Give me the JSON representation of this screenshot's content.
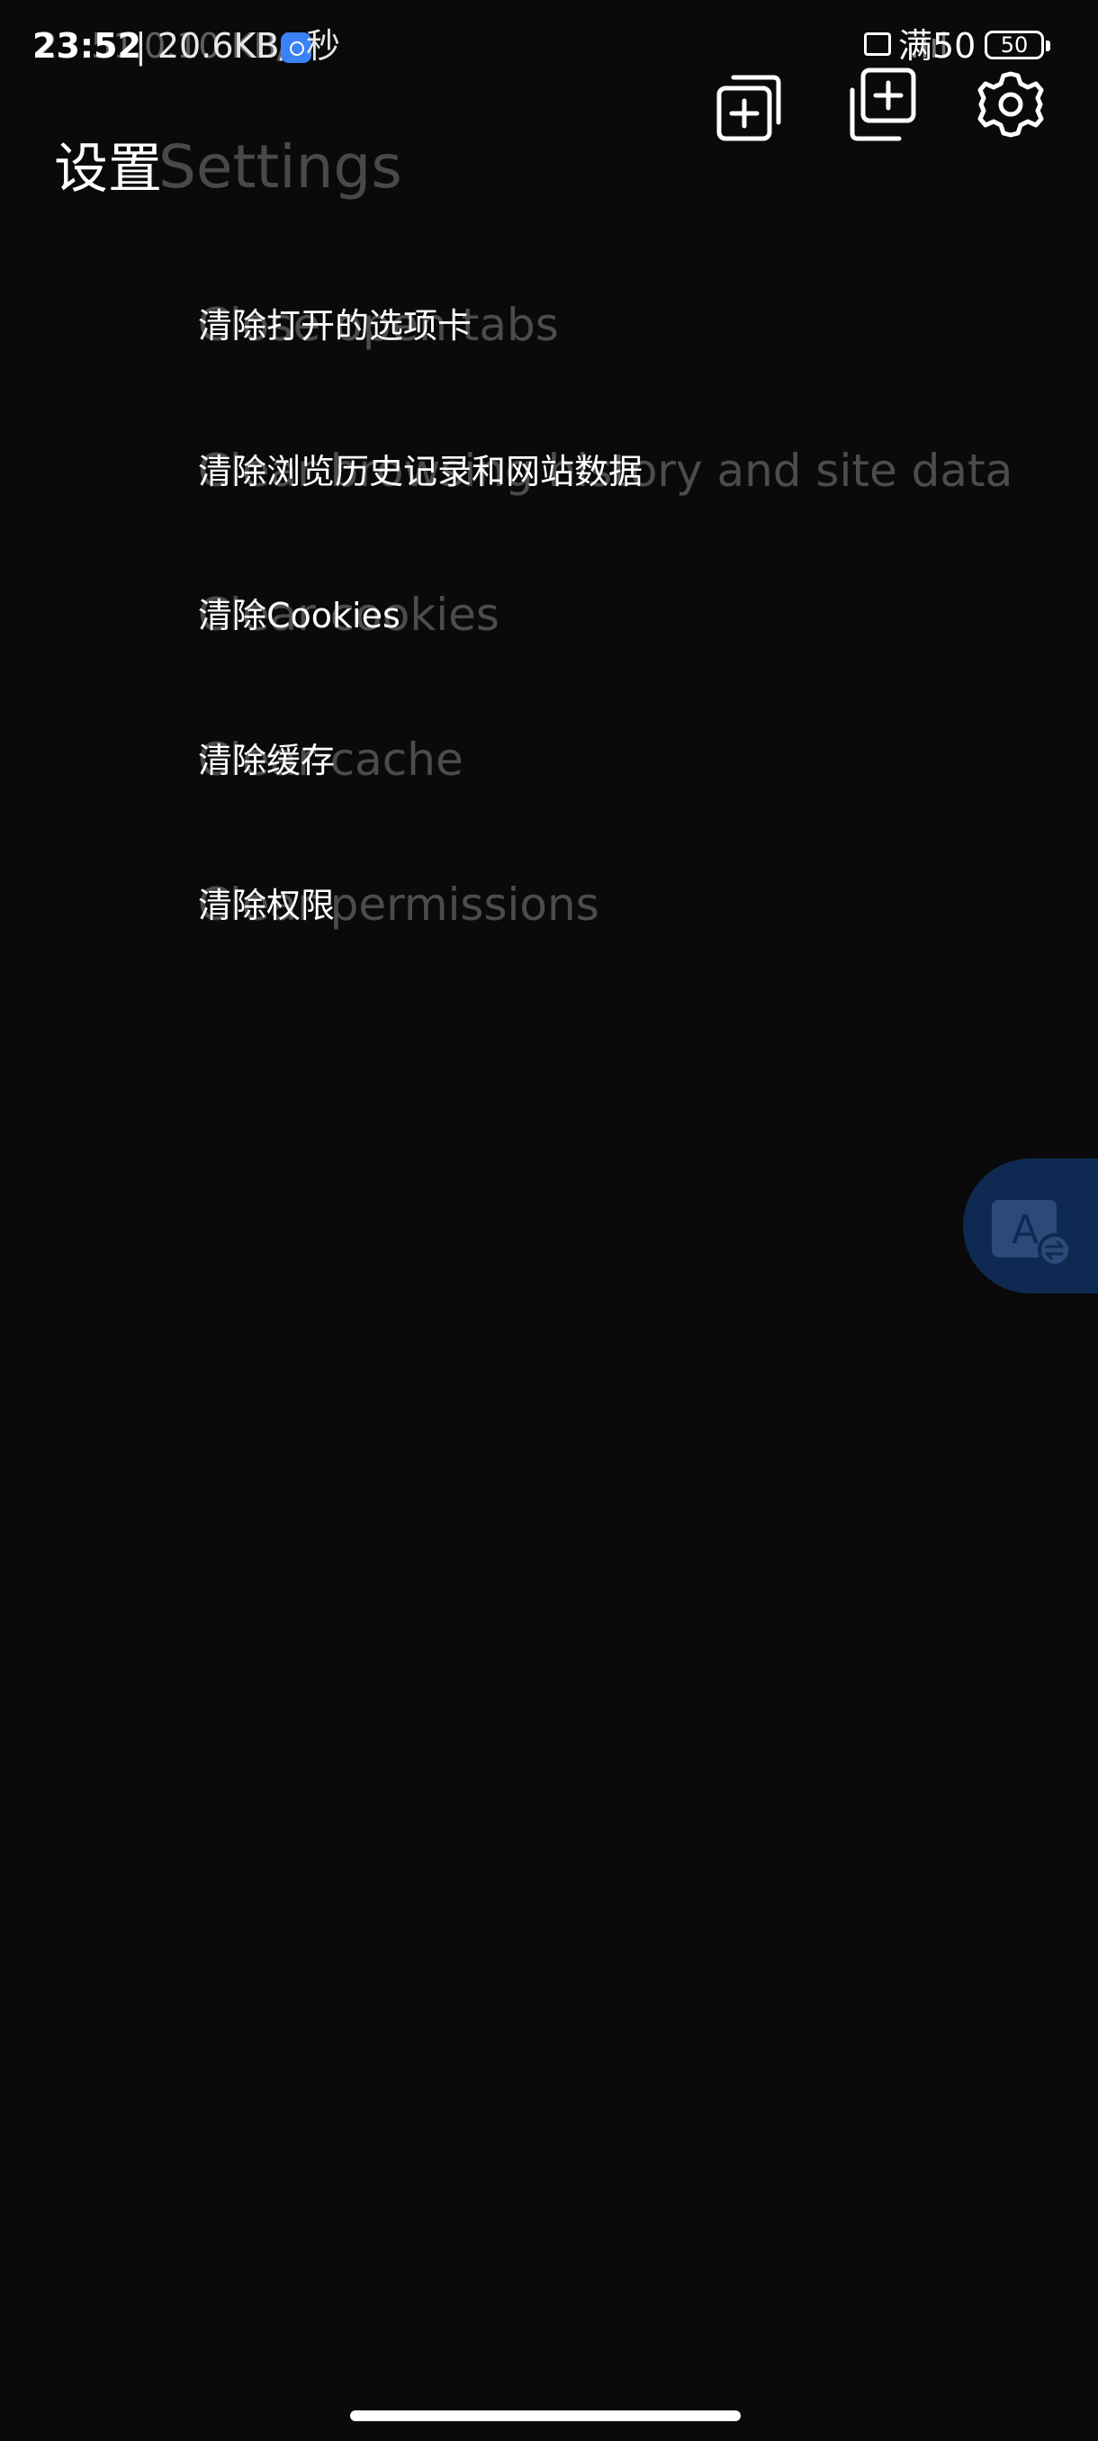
{
  "status_bar": {
    "time": "23:52",
    "time_ghost": "23:51",
    "net_speed": "| 20.6KB/s",
    "net_speed_ghost": "0.10 KB/s",
    "speed_suffix": "秒",
    "carrier": "满50",
    "carrier_ghost": ".ııl",
    "battery": "50",
    "app_icon": "message-app-icon",
    "sim_icon": "sim-card-icon"
  },
  "toolbar": {
    "duplicate_tab_icon": "duplicate-tab-icon",
    "new_tab_icon": "new-tab-icon",
    "settings_icon": "gear-icon"
  },
  "header": {
    "title_cn": "设置",
    "title_en": "Settings"
  },
  "menu": {
    "items": [
      {
        "cn": "清除打开的选项卡",
        "en": "Close open tabs"
      },
      {
        "cn": "清除浏览历史记录和网站数据",
        "en": "Clear browsing history and site data"
      },
      {
        "cn": "清除Cookies",
        "en": "Clear cookies"
      },
      {
        "cn": "清除缓存",
        "en": "Clear cache"
      },
      {
        "cn": "清除权限",
        "en": "Clear permissions"
      }
    ]
  },
  "floating": {
    "translate_icon": "translate-icon",
    "accent_color": "#0f2a52"
  },
  "colors": {
    "background": "#0a0a0a",
    "text_primary": "#ffffff",
    "text_ghost": "rgba(255,255,255,0.27)"
  }
}
